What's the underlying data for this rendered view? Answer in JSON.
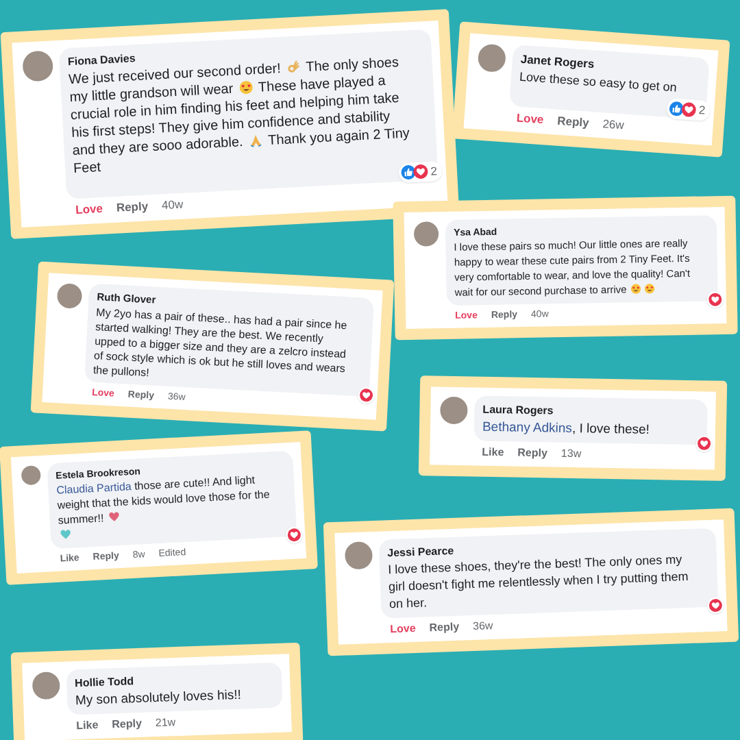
{
  "comments": [
    {
      "author": "Fiona Davies",
      "body": [
        {
          "kind": "text",
          "text": "We just received our second order!"
        },
        {
          "kind": "emoji-ok"
        },
        {
          "kind": "text",
          "text": "The only shoes my little grandson will wear"
        },
        {
          "kind": "emoji-hearteyes"
        },
        {
          "kind": "text",
          "text": "These have played a crucial role in him finding his feet and helping him take his first steps! They give him confidence and stability and they are sooo adorable."
        },
        {
          "kind": "emoji-pray"
        },
        {
          "kind": "text",
          "text": "Thank you again 2 Tiny Feet"
        }
      ],
      "reaction": {
        "kind": "like-love",
        "count": "2"
      },
      "action": {
        "label": "Love",
        "selected": true
      },
      "reply": "Reply",
      "time": "40w"
    },
    {
      "author": "Janet Rogers",
      "body": [
        {
          "kind": "text",
          "text": "Love these so easy to get on"
        }
      ],
      "reaction": {
        "kind": "like-love",
        "count": "2"
      },
      "action": {
        "label": "Love",
        "selected": true
      },
      "reply": "Reply",
      "time": "26w"
    },
    {
      "author": "Ysa Abad",
      "body": [
        {
          "kind": "text",
          "text": "I love these pairs so much! Our little ones are really happy to wear these cute pairs from 2 Tiny Feet. It's very comfortable to wear, and love the quality! Can't wait for our second purchase to arrive"
        },
        {
          "kind": "emoji-hearteyes"
        },
        {
          "kind": "emoji-hearteyes"
        }
      ],
      "reaction": {
        "kind": "love"
      },
      "action": {
        "label": "Love",
        "selected": true
      },
      "reply": "Reply",
      "time": "40w"
    },
    {
      "author": "Ruth Glover",
      "body": [
        {
          "kind": "text",
          "text": "My 2yo has a pair of these.. has had a pair since he started walking! They are the best. We recently upped to a bigger size and they are a zelcro instead of sock style which is ok but he still loves and wears the pullons!"
        }
      ],
      "reaction": {
        "kind": "love"
      },
      "action": {
        "label": "Love",
        "selected": true
      },
      "reply": "Reply",
      "time": "36w"
    },
    {
      "author": "Estela Brookreson",
      "body": [
        {
          "kind": "mention",
          "text": "Claudia Partida"
        },
        {
          "kind": "text",
          "text": "those are cute!! And light weight that the kids would love those for the summer!!"
        },
        {
          "kind": "emoji-heart",
          "color": "#e0637a"
        },
        {
          "kind": "break"
        },
        {
          "kind": "emoji-heart",
          "color": "#5ec7c9"
        }
      ],
      "reaction": {
        "kind": "love"
      },
      "action": {
        "label": "Like",
        "selected": false
      },
      "reply": "Reply",
      "time": "8w",
      "edited": "Edited"
    },
    {
      "author": "Laura Rogers",
      "body": [
        {
          "kind": "mention",
          "text": "Bethany Adkins"
        },
        {
          "kind": "text",
          "text": ", I love these!"
        }
      ],
      "reaction": {
        "kind": "love"
      },
      "action": {
        "label": "Like",
        "selected": false
      },
      "reply": "Reply",
      "time": "13w"
    },
    {
      "author": "Jessi Pearce",
      "body": [
        {
          "kind": "text",
          "text": "I love these shoes, they're the best! The only ones my girl doesn't fight me relentlessly when I try putting them on her."
        }
      ],
      "reaction": {
        "kind": "love"
      },
      "action": {
        "label": "Love",
        "selected": true
      },
      "reply": "Reply",
      "time": "36w"
    },
    {
      "author": "Hollie Todd",
      "body": [
        {
          "kind": "text",
          "text": "My son absolutely loves his!!"
        }
      ],
      "action": {
        "label": "Like",
        "selected": false
      },
      "reply": "Reply",
      "time": "21w"
    }
  ]
}
